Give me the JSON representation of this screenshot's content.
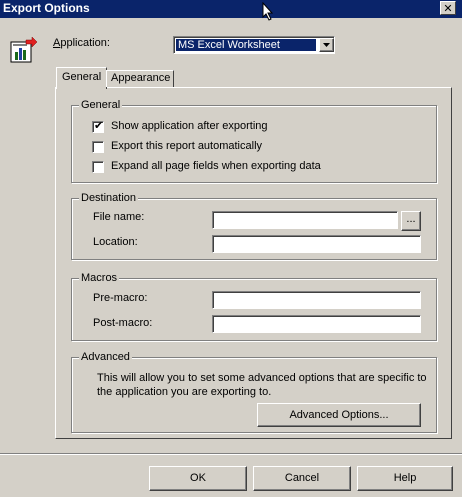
{
  "window": {
    "title": "Export Options",
    "close_glyph": "✕"
  },
  "application": {
    "label": "Application:",
    "selected": "MS Excel Worksheet"
  },
  "tabs": [
    {
      "label": "General"
    },
    {
      "label": "Appearance"
    }
  ],
  "general_group": {
    "legend": "General",
    "options": [
      {
        "label": "Show application after exporting",
        "checked": true
      },
      {
        "label": "Export this report automatically",
        "checked": false
      },
      {
        "label": "Expand all page fields when exporting data",
        "checked": false
      }
    ]
  },
  "destination": {
    "legend": "Destination",
    "file_name_label": "File name:",
    "file_name_value": "",
    "browse_label": "...",
    "location_label": "Location:",
    "location_value": ""
  },
  "macros": {
    "legend": "Macros",
    "pre_label": "Pre-macro:",
    "pre_value": "",
    "post_label": "Post-macro:",
    "post_value": ""
  },
  "advanced": {
    "legend": "Advanced",
    "description": "This will allow you to set some advanced options that are specific to the application you are exporting to.",
    "button_label": "Advanced Options..."
  },
  "footer": {
    "ok_label": "OK",
    "cancel_label": "Cancel",
    "help_label": "Help"
  },
  "colors": {
    "titlebar": "#0a246a",
    "face": "#d4d0c8"
  }
}
